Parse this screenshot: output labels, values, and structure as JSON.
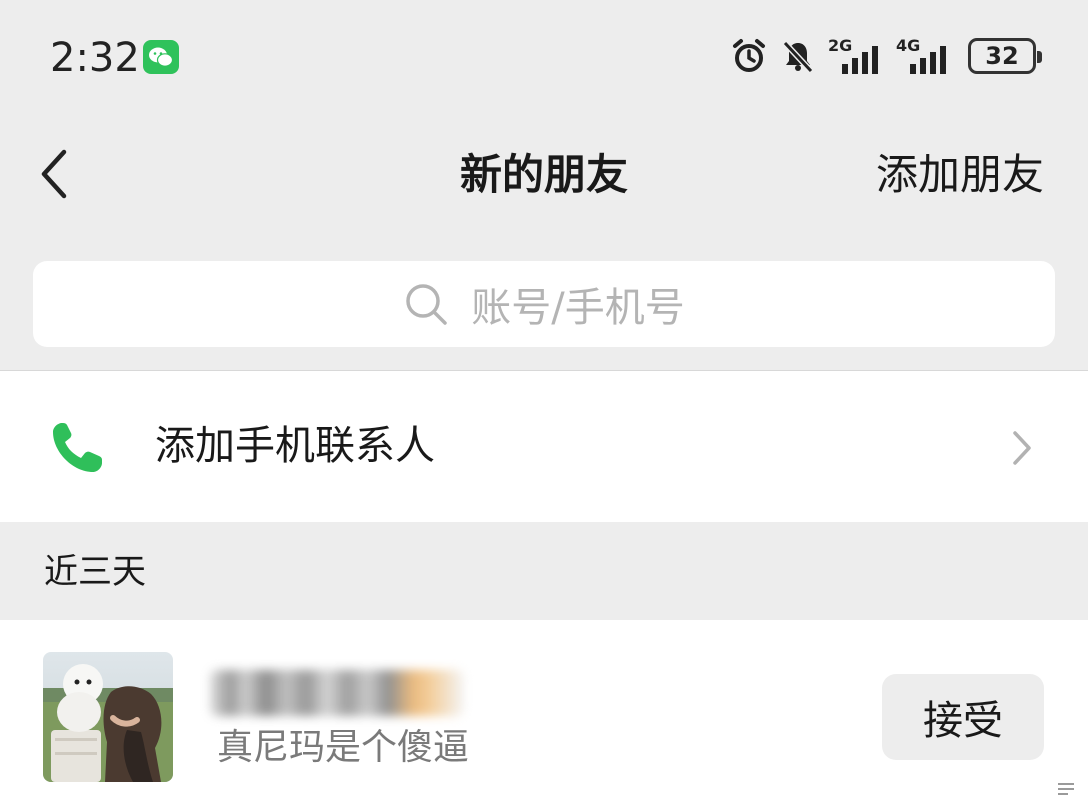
{
  "status_bar": {
    "time": "2:32",
    "battery_level": "32",
    "network_1": "2G",
    "network_2": "4G",
    "icons": [
      "wechat-notification-icon",
      "alarm-icon",
      "mute-bell-icon",
      "signal-2g-icon",
      "signal-4g-icon",
      "battery-icon"
    ]
  },
  "nav": {
    "title": "新的朋友",
    "action_label": "添加朋友",
    "back_icon": "back-chevron-icon"
  },
  "search": {
    "placeholder": "账号/手机号",
    "icon": "search-icon"
  },
  "add_phone_contacts": {
    "label": "添加手机联系人",
    "icon": "phone-icon",
    "icon_color": "#2fbf5a",
    "chevron_icon": "chevron-right-icon"
  },
  "section": {
    "title": "近三天"
  },
  "requests": [
    {
      "message": "真尼玛是个傻逼",
      "accept_label": "接受",
      "avatar": "avatar-photo"
    }
  ],
  "colors": {
    "background": "#ededed",
    "card": "#ffffff",
    "accent_green": "#2fc25b",
    "secondary_text": "#7a7a7a",
    "placeholder_text": "#b4b4b4"
  }
}
